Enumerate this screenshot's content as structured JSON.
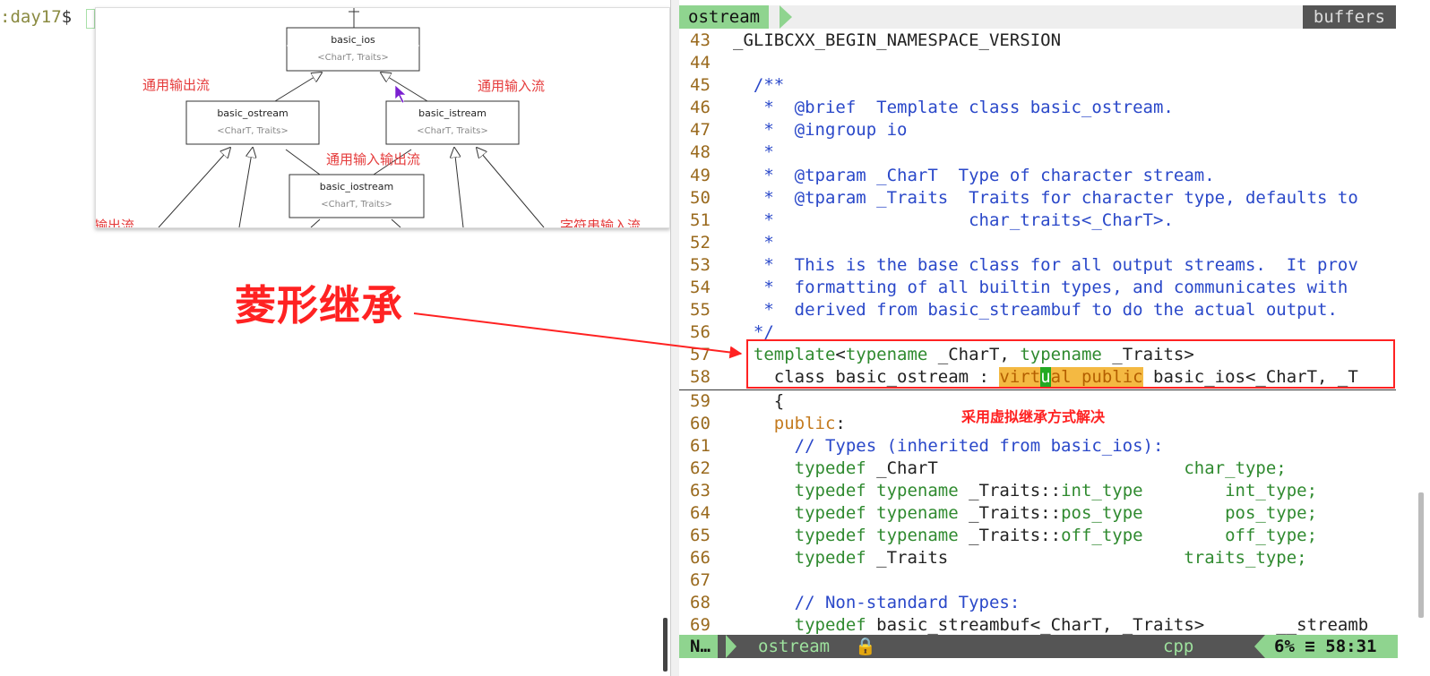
{
  "terminal": {
    "prompt_host": ":day17",
    "prompt_symbol": "$"
  },
  "diagram": {
    "boxes": [
      {
        "title": "basic_ios",
        "param": "<CharT, Traits>"
      },
      {
        "title": "basic_ostream",
        "param": "<CharT, Traits>"
      },
      {
        "title": "basic_istream",
        "param": "<CharT, Traits>"
      },
      {
        "title": "basic_iostream",
        "param": "<CharT, Traits>"
      }
    ],
    "labels": {
      "general_output": "通用输出流",
      "general_input": "通用输入流",
      "general_io": "通用输入输出流",
      "cut_left": "输出流",
      "cut_right": "字符串输入流"
    }
  },
  "annotations": {
    "big_label": "菱形继承",
    "note": "采用虚拟继承方式解决"
  },
  "vim": {
    "tab_active": "ostream",
    "tab_buffers": "buffers",
    "lines": [
      {
        "n": "43",
        "t": [
          [
            "_GLIBCXX_BEGIN_NAMESPACE_VERSION",
            "text"
          ]
        ]
      },
      {
        "n": "44",
        "t": []
      },
      {
        "n": "45",
        "t": [
          [
            "  /**",
            "blue"
          ]
        ]
      },
      {
        "n": "46",
        "t": [
          [
            "   *  @brief  Template class basic_ostream.",
            "blue"
          ]
        ]
      },
      {
        "n": "47",
        "t": [
          [
            "   *  @ingroup io",
            "blue"
          ]
        ]
      },
      {
        "n": "48",
        "t": [
          [
            "   *",
            "blue"
          ]
        ]
      },
      {
        "n": "49",
        "t": [
          [
            "   *  @tparam _CharT  Type of character stream.",
            "blue"
          ]
        ]
      },
      {
        "n": "50",
        "t": [
          [
            "   *  @tparam _Traits  Traits for character type, defaults to",
            "blue"
          ]
        ]
      },
      {
        "n": "51",
        "t": [
          [
            "   *                   char_traits<_CharT>.",
            "blue"
          ]
        ]
      },
      {
        "n": "52",
        "t": [
          [
            "   *",
            "blue"
          ]
        ]
      },
      {
        "n": "53",
        "t": [
          [
            "   *  This is the base class for all output streams.  It prov",
            "blue"
          ]
        ]
      },
      {
        "n": "54",
        "t": [
          [
            "   *  formatting of all builtin types, and communicates with",
            "blue"
          ]
        ]
      },
      {
        "n": "55",
        "t": [
          [
            "   *  derived from basic_streambuf to do the actual output.",
            "blue"
          ]
        ]
      },
      {
        "n": "56",
        "t": [
          [
            "  */",
            "blue"
          ]
        ]
      },
      {
        "n": "57",
        "t": [
          [
            "  template",
            "green"
          ],
          [
            "<",
            "text"
          ],
          [
            "typename",
            "green"
          ],
          [
            " _CharT, ",
            "text"
          ],
          [
            "typename",
            "green"
          ],
          [
            " _Traits>",
            "text"
          ]
        ]
      },
      {
        "n": "58",
        "t": [
          [
            "    class basic_ostream : ",
            "text"
          ],
          [
            "virt",
            "hl"
          ],
          [
            "u",
            "cursor"
          ],
          [
            "al public",
            "hl"
          ],
          [
            " basic_ios<_CharT, _T",
            "text"
          ]
        ]
      },
      {
        "n": "59",
        "t": [
          [
            "    {",
            "text"
          ]
        ]
      },
      {
        "n": "60",
        "t": [
          [
            "    ",
            "text"
          ],
          [
            "public",
            "orange"
          ],
          [
            ":",
            "text"
          ]
        ]
      },
      {
        "n": "61",
        "t": [
          [
            "      // Types (inherited from basic_ios):",
            "blue"
          ]
        ]
      },
      {
        "n": "62",
        "t": [
          [
            "      ",
            "text"
          ],
          [
            "typedef",
            "green"
          ],
          [
            " _CharT                        ",
            "text"
          ],
          [
            "char_type;",
            "green"
          ]
        ]
      },
      {
        "n": "63",
        "t": [
          [
            "      ",
            "text"
          ],
          [
            "typedef typename",
            "green"
          ],
          [
            " _Traits::",
            "text"
          ],
          [
            "int_type",
            "green"
          ],
          [
            "        ",
            "text"
          ],
          [
            "int_type;",
            "green"
          ]
        ]
      },
      {
        "n": "64",
        "t": [
          [
            "      ",
            "text"
          ],
          [
            "typedef typename",
            "green"
          ],
          [
            " _Traits::",
            "text"
          ],
          [
            "pos_type",
            "green"
          ],
          [
            "        ",
            "text"
          ],
          [
            "pos_type;",
            "green"
          ]
        ]
      },
      {
        "n": "65",
        "t": [
          [
            "      ",
            "text"
          ],
          [
            "typedef typename",
            "green"
          ],
          [
            " _Traits::",
            "text"
          ],
          [
            "off_type",
            "green"
          ],
          [
            "        ",
            "text"
          ],
          [
            "off_type;",
            "green"
          ]
        ]
      },
      {
        "n": "66",
        "t": [
          [
            "      ",
            "text"
          ],
          [
            "typedef",
            "green"
          ],
          [
            " _Traits                       ",
            "text"
          ],
          [
            "traits_type;",
            "green"
          ]
        ]
      },
      {
        "n": "67",
        "t": []
      },
      {
        "n": "68",
        "t": [
          [
            "      // Non-standard Types:",
            "blue"
          ]
        ]
      },
      {
        "n": "69",
        "t": [
          [
            "      ",
            "text"
          ],
          [
            "typedef",
            "green"
          ],
          [
            " basic_streambuf<_CharT, _Traits>       __streamb",
            "text"
          ]
        ]
      }
    ],
    "status": {
      "mode": "N…",
      "file": "ostream",
      "filetype": "cpp",
      "percent": "6%",
      "sep": "≡",
      "position": "58:31"
    }
  }
}
